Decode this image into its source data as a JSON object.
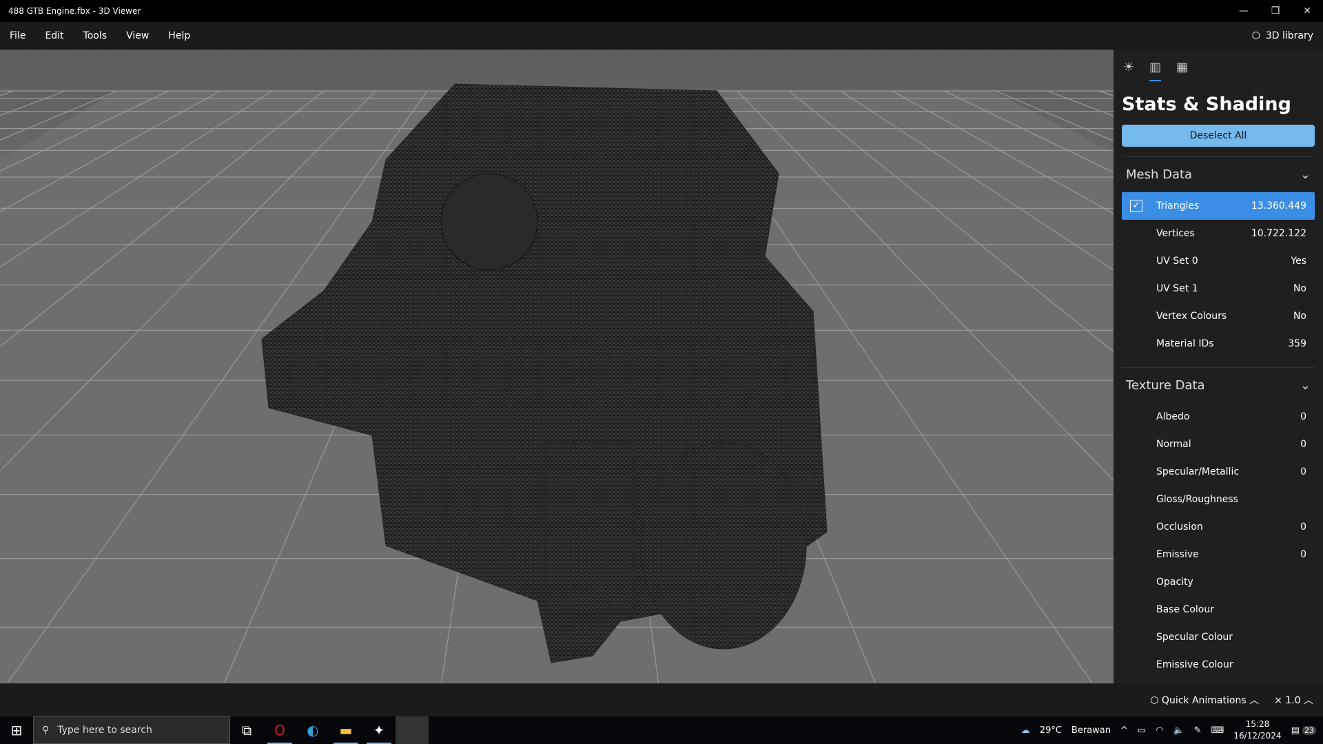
{
  "window": {
    "title": "488 GTB Engine.fbx - 3D Viewer"
  },
  "menu": {
    "items": [
      "File",
      "Edit",
      "Tools",
      "View",
      "Help"
    ],
    "library": "3D library"
  },
  "panel": {
    "title": "Stats & Shading",
    "deselect": "Deselect All",
    "mesh": {
      "header": "Mesh Data",
      "rows": [
        {
          "label": "Triangles",
          "value": "13.360.449",
          "checked": true
        },
        {
          "label": "Vertices",
          "value": "10.722.122"
        },
        {
          "label": "UV Set 0",
          "value": "Yes"
        },
        {
          "label": "UV Set 1",
          "value": "No"
        },
        {
          "label": "Vertex Colours",
          "value": "No"
        },
        {
          "label": "Material IDs",
          "value": "359"
        }
      ]
    },
    "texture": {
      "header": "Texture Data",
      "rows": [
        {
          "label": "Albedo",
          "value": "0"
        },
        {
          "label": "Normal",
          "value": "0"
        },
        {
          "label": "Specular/Metallic",
          "value": "0"
        },
        {
          "label": "Gloss/Roughness",
          "value": ""
        },
        {
          "label": "Occlusion",
          "value": "0"
        },
        {
          "label": "Emissive",
          "value": "0"
        },
        {
          "label": "Opacity",
          "value": ""
        },
        {
          "label": "Base Colour",
          "value": ""
        },
        {
          "label": "Specular Colour",
          "value": ""
        },
        {
          "label": "Emissive Colour",
          "value": ""
        }
      ]
    }
  },
  "bottom": {
    "quick_animations": "Quick Animations",
    "speed": "× 1.0"
  },
  "taskbar": {
    "search_placeholder": "Type here to search",
    "weather": "29°C",
    "weather_desc": "Berawan",
    "time": "15:28",
    "date": "16/12/2024",
    "notifications": "23"
  }
}
